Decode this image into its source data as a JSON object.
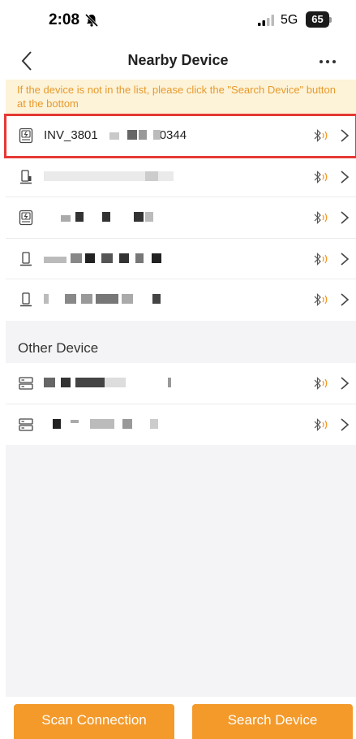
{
  "status_bar": {
    "time": "2:08",
    "network": "5G",
    "battery": "65"
  },
  "nav": {
    "title": "Nearby Device"
  },
  "notice": {
    "text": "If the device is not in the list, please click the \"Search Device\" button at the bottom"
  },
  "nearby_devices": [
    {
      "label": "INV_3801",
      "label_suffix": "0344",
      "icon": "inverter-icon",
      "selected": true
    },
    {
      "label": "",
      "label_suffix": "",
      "icon": "battery-tower-icon",
      "selected": false
    },
    {
      "label": "",
      "label_suffix": "",
      "icon": "inverter-icon",
      "selected": false
    },
    {
      "label": "",
      "label_suffix": "",
      "icon": "battery-tower-icon",
      "selected": false
    },
    {
      "label": "",
      "label_suffix": "",
      "icon": "battery-tower-icon",
      "selected": false
    }
  ],
  "other_section": {
    "title": "Other Device"
  },
  "other_devices": [
    {
      "label": "",
      "icon": "server-icon"
    },
    {
      "label": "",
      "icon": "server-icon"
    }
  ],
  "buttons": {
    "scan": "Scan Connection",
    "search": "Search Device"
  },
  "colors": {
    "accent": "#f39a2b",
    "notice_bg": "#fdf3d8",
    "notice_text": "#e69a2e",
    "highlight": "#e53935"
  }
}
